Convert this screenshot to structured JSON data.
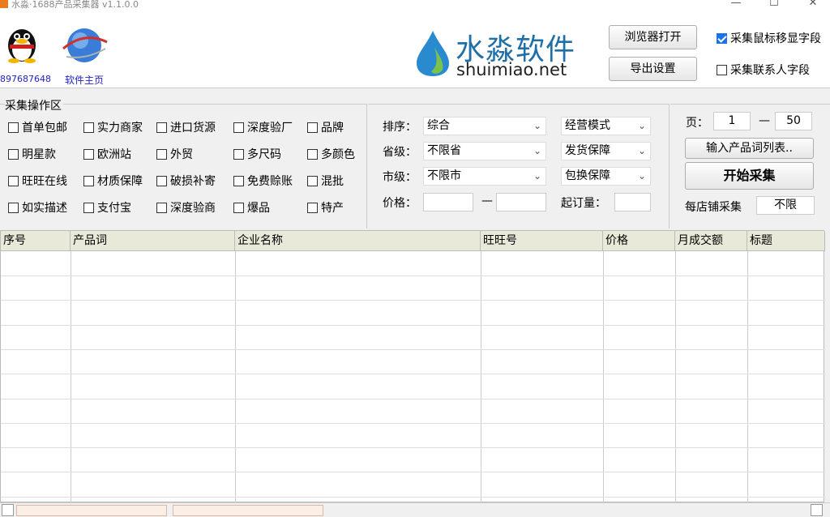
{
  "window": {
    "title": "水淼·1688产品采集器 v1.1.0.0",
    "min": "—",
    "max": "☐",
    "close": "✕"
  },
  "header": {
    "qq_number": "897687648",
    "home_link": "软件主页",
    "logo_cn": "水淼软件",
    "logo_en": "shuimiao.net",
    "browser_button": "浏览器打开",
    "export_button": "导出设置",
    "check_mouse_field": {
      "label": "采集鼠标移显字段",
      "checked": true
    },
    "check_contact_field": {
      "label": "采集联系人字段",
      "checked": false
    }
  },
  "ops": {
    "title": "采集操作区",
    "checkboxes": [
      [
        "首单包邮",
        "实力商家",
        "进口货源",
        "深度验厂",
        "品牌"
      ],
      [
        "明星款",
        "欧洲站",
        "外贸",
        "多尺码",
        "多颜色"
      ],
      [
        "旺旺在线",
        "材质保障",
        "破损补寄",
        "免费赊账",
        "混批"
      ],
      [
        "如实描述",
        "支付宝",
        "深度验商",
        "爆品",
        "特产"
      ]
    ],
    "sort_label": "排序：",
    "sort_value": "综合",
    "province_label": "省级：",
    "province_value": "不限省",
    "city_label": "市级：",
    "city_value": "不限市",
    "price_label": "价格：",
    "price_sep": "—",
    "mode_value": "经营模式",
    "ship_value": "发货保障",
    "exchange_value": "包换保障",
    "moq_label": "起订量：",
    "page_label": "页：",
    "page_from": "1",
    "page_sep": "—",
    "page_to": "50",
    "keywords_button": "输入产品词列表..",
    "start_button": "开始采集",
    "per_shop_label": "每店铺采集",
    "per_shop_value": "不限"
  },
  "table": {
    "columns": [
      "序号",
      "产品词",
      "企业名称",
      "旺旺号",
      "价格",
      "月成交额",
      "标题"
    ]
  },
  "colors": {
    "logo_blue": "#1f6fa8",
    "link": "#2222cc",
    "header_bg": "#e9e9d9"
  }
}
